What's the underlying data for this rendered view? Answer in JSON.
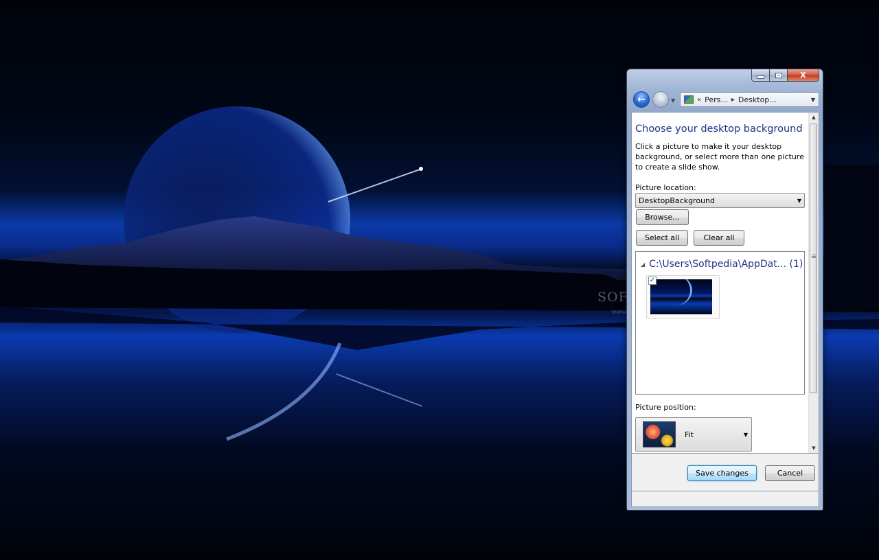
{
  "wallpaper": {
    "watermark": "SOFTPEDIA",
    "watermark_url": "www.softpedia.com"
  },
  "window": {
    "caption_buttons": {
      "close": "X"
    },
    "nav": {
      "address": {
        "overflow": "«",
        "crumb1": "Pers...",
        "crumb2": "Desktop..."
      }
    },
    "content": {
      "title": "Choose your desktop background",
      "description": "Click a picture to make it your desktop background, or select more than one picture to create a slide show.",
      "location_label": "Picture location:",
      "location_value": "DesktopBackground",
      "browse_label": "Browse...",
      "select_all_label": "Select all",
      "clear_all_label": "Clear all",
      "group_header": "C:\\Users\\Softpedia\\AppDat... (1)",
      "thumbnail_checked": "✓",
      "position_label": "Picture position:",
      "position_value": "Fit"
    },
    "footer": {
      "save_label": "Save changes",
      "cancel_label": "Cancel"
    }
  },
  "colors": {
    "accent_title": "#1e3287",
    "save_button_border": "#3c7fb1",
    "close_button": "#c0391e"
  },
  "icons": [
    "back-arrow-icon",
    "forward-arrow-icon",
    "control-panel-icon",
    "chevron-down-icon",
    "collapse-triangle-icon",
    "checkbox-icon",
    "picture-position-icon"
  ]
}
